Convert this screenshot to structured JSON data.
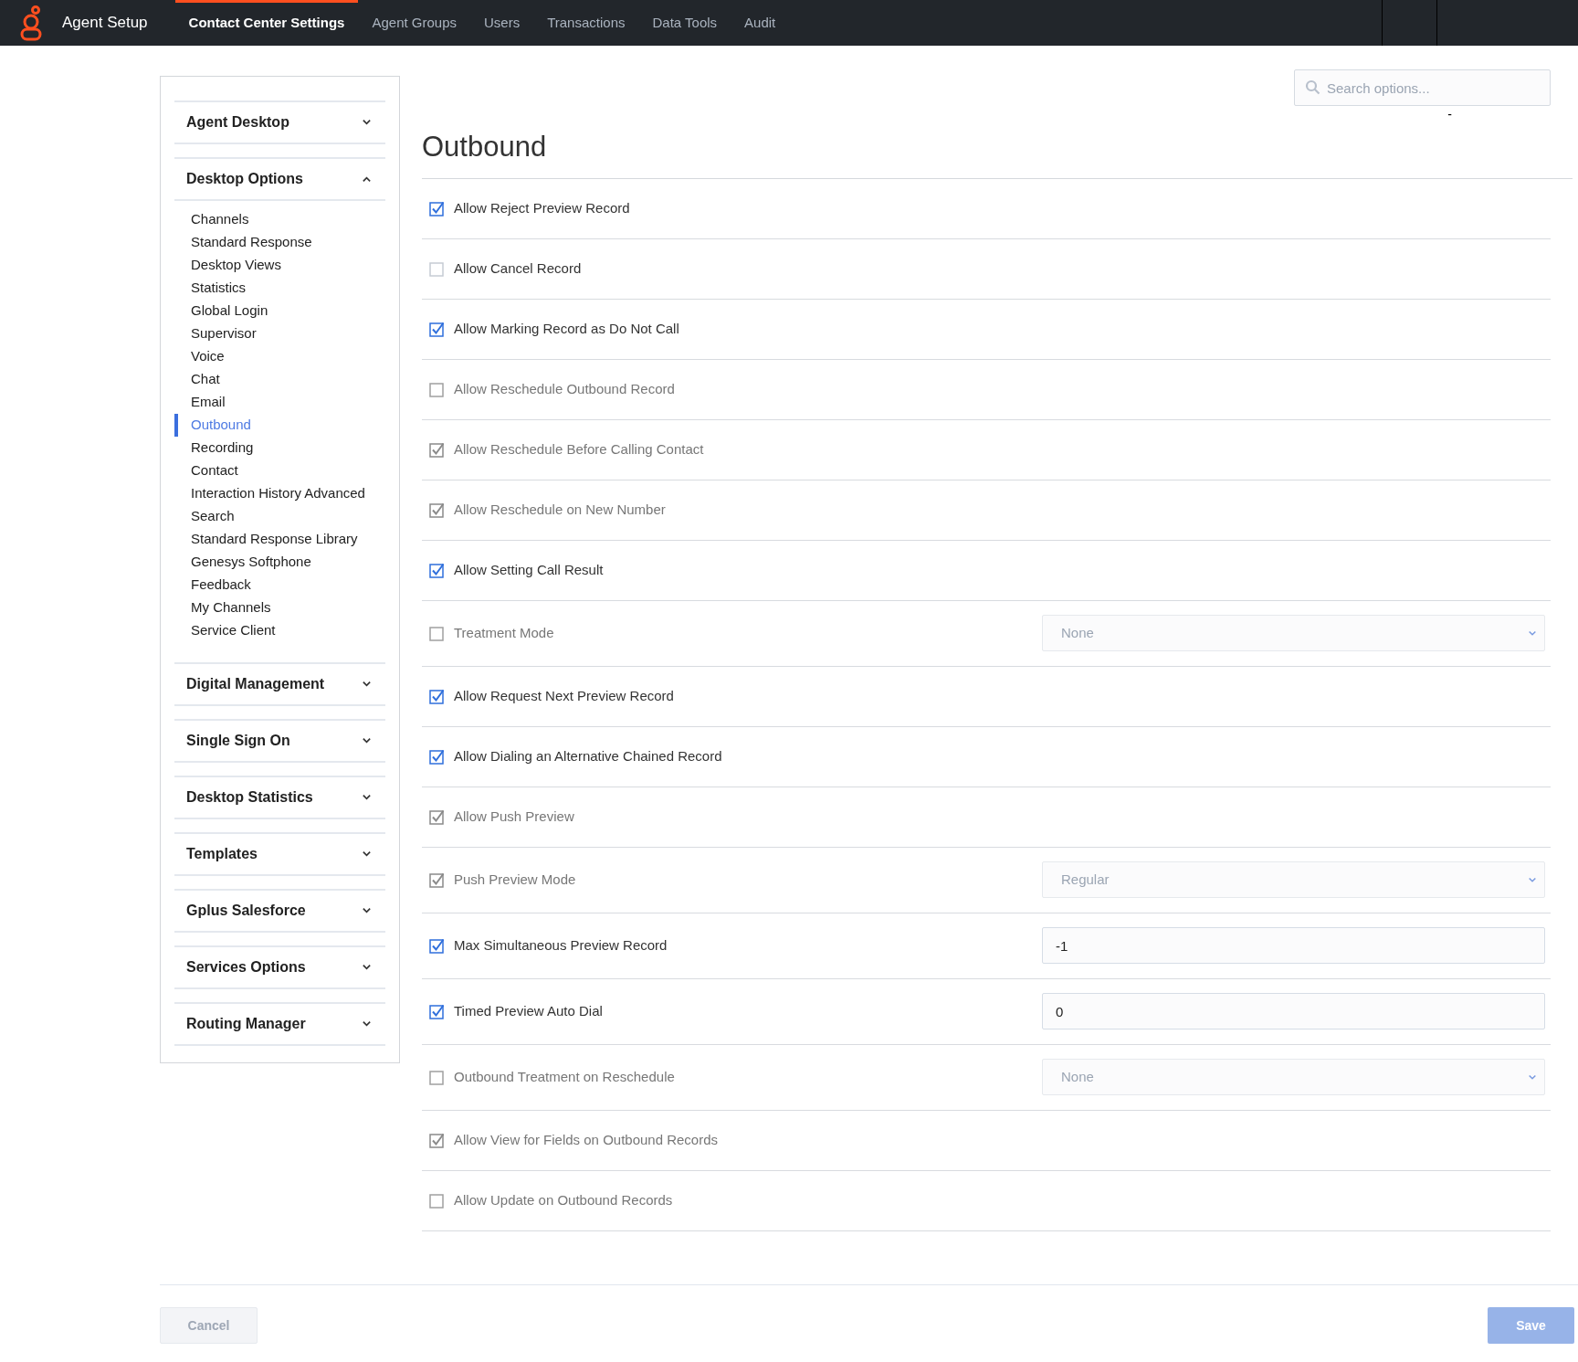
{
  "topbar": {
    "app_title": "Agent Setup",
    "tabs": [
      {
        "label": "Contact Center Settings",
        "selected": true
      },
      {
        "label": "Agent Groups",
        "selected": false
      },
      {
        "label": "Users",
        "selected": false
      },
      {
        "label": "Transactions",
        "selected": false
      },
      {
        "label": "Data Tools",
        "selected": false
      },
      {
        "label": "Audit",
        "selected": false
      }
    ]
  },
  "sidebar": {
    "sections": [
      {
        "label": "Agent Desktop",
        "expanded": false
      },
      {
        "label": "Desktop Options",
        "expanded": true,
        "items": [
          {
            "label": "Channels",
            "selected": false
          },
          {
            "label": "Standard Response",
            "selected": false
          },
          {
            "label": "Desktop Views",
            "selected": false
          },
          {
            "label": "Statistics",
            "selected": false
          },
          {
            "label": "Global Login",
            "selected": false
          },
          {
            "label": "Supervisor",
            "selected": false
          },
          {
            "label": "Voice",
            "selected": false
          },
          {
            "label": "Chat",
            "selected": false
          },
          {
            "label": "Email",
            "selected": false
          },
          {
            "label": "Outbound",
            "selected": true
          },
          {
            "label": "Recording",
            "selected": false
          },
          {
            "label": "Contact",
            "selected": false
          },
          {
            "label": "Interaction History Advanced",
            "selected": false
          },
          {
            "label": "Search",
            "selected": false
          },
          {
            "label": "Standard Response Library",
            "selected": false
          },
          {
            "label": "Genesys Softphone",
            "selected": false
          },
          {
            "label": "Feedback",
            "selected": false
          },
          {
            "label": "My Channels",
            "selected": false
          },
          {
            "label": "Service Client",
            "selected": false
          }
        ]
      },
      {
        "label": "Digital Management",
        "expanded": false
      },
      {
        "label": "Single Sign On",
        "expanded": false
      },
      {
        "label": "Desktop Statistics",
        "expanded": false
      },
      {
        "label": "Templates",
        "expanded": false
      },
      {
        "label": "Gplus Salesforce",
        "expanded": false
      },
      {
        "label": "Services Options",
        "expanded": false
      },
      {
        "label": "Routing Manager",
        "expanded": false
      }
    ]
  },
  "search": {
    "placeholder": "Search options..."
  },
  "search_note": "-",
  "page_title": "Outbound",
  "settings": [
    {
      "kind": "checkbox",
      "label": "Allow Reject Preview Record",
      "checked": true,
      "disabled": false
    },
    {
      "kind": "checkbox",
      "label": "Allow Cancel Record",
      "checked": false,
      "disabled": false
    },
    {
      "kind": "checkbox",
      "label": "Allow Marking Record as Do Not Call",
      "checked": true,
      "disabled": false
    },
    {
      "kind": "checkbox",
      "label": "Allow Reschedule Outbound Record",
      "checked": false,
      "disabled": true
    },
    {
      "kind": "checkbox",
      "label": "Allow Reschedule Before Calling Contact",
      "checked": true,
      "disabled": true
    },
    {
      "kind": "checkbox",
      "label": "Allow Reschedule on New Number",
      "checked": true,
      "disabled": true
    },
    {
      "kind": "checkbox",
      "label": "Allow Setting Call Result",
      "checked": true,
      "disabled": false
    },
    {
      "kind": "select",
      "label": "Treatment Mode",
      "checked": false,
      "disabled": true,
      "value": "None"
    },
    {
      "kind": "checkbox",
      "label": "Allow Request Next Preview Record",
      "checked": true,
      "disabled": false
    },
    {
      "kind": "checkbox",
      "label": "Allow Dialing an Alternative Chained Record",
      "checked": true,
      "disabled": false
    },
    {
      "kind": "checkbox",
      "label": "Allow Push Preview",
      "checked": true,
      "disabled": true
    },
    {
      "kind": "select",
      "label": "Push Preview Mode",
      "checked": true,
      "disabled": true,
      "value": "Regular"
    },
    {
      "kind": "input",
      "label": "Max Simultaneous Preview Record",
      "checked": true,
      "disabled": false,
      "value": "-1"
    },
    {
      "kind": "input",
      "label": "Timed Preview Auto Dial",
      "checked": true,
      "disabled": false,
      "value": "0"
    },
    {
      "kind": "select",
      "label": "Outbound Treatment on Reschedule",
      "checked": false,
      "disabled": true,
      "value": "None"
    },
    {
      "kind": "checkbox",
      "label": "Allow View for Fields on Outbound Records",
      "checked": true,
      "disabled": true
    },
    {
      "kind": "checkbox",
      "label": "Allow Update on Outbound Records",
      "checked": false,
      "disabled": true
    }
  ],
  "footer": {
    "cancel": {
      "label": "Cancel",
      "disabled": true
    },
    "save": {
      "label": "Save",
      "disabled": true
    }
  }
}
